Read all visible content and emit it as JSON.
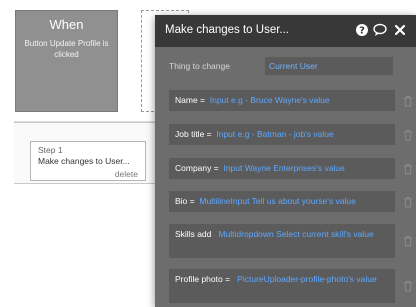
{
  "canvas": {
    "when_title": "When",
    "when_desc": "Button Update Profile is clicked",
    "step_label": "Step 1",
    "step_title": "Make changes to User...",
    "step_delete": "delete"
  },
  "panel": {
    "title": "Make changes to User...",
    "thing_label": "Thing to change",
    "thing_value": "Current User",
    "fields": [
      {
        "label": "Name =",
        "value": "Input e.g - Bruce Wayne's value"
      },
      {
        "label": "Job title =",
        "value": "Input e.g - Batman - job's value"
      },
      {
        "label": "Company =",
        "value": "Input Wayne Enterprises's value"
      },
      {
        "label": "Bio =",
        "value": "MultilineInput Tell us about yourse's value"
      },
      {
        "label": "Skills add",
        "value": "Multidropdown Select current skill's value"
      },
      {
        "label": "Profile photo =",
        "value": "PictureUploader-profile-photo's value"
      }
    ]
  },
  "colors": {
    "header_bg": "#383838",
    "panel_bg": "#6d6d6d",
    "row_bg": "#5b5b5b",
    "link_blue": "#5ea8ff"
  }
}
